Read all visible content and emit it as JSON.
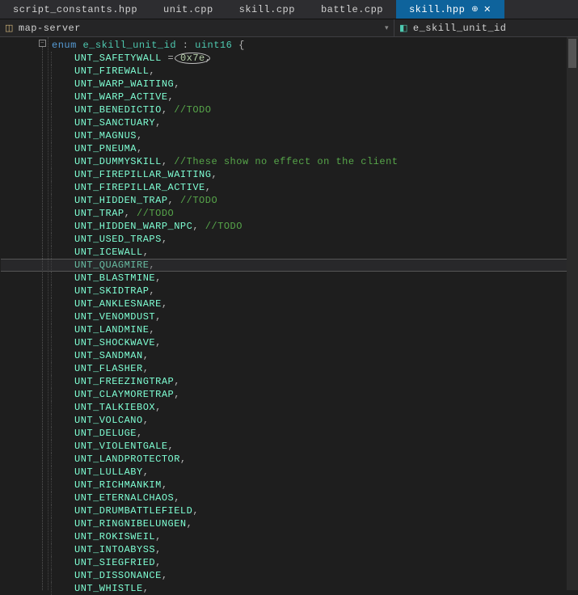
{
  "tabs": [
    {
      "label": "script_constants.hpp",
      "active": false
    },
    {
      "label": "unit.cpp",
      "active": false
    },
    {
      "label": "skill.cpp",
      "active": false
    },
    {
      "label": "battle.cpp",
      "active": false
    },
    {
      "label": "skill.hpp",
      "active": true
    }
  ],
  "subbar": {
    "left": "map-server",
    "right": "e_skill_unit_id"
  },
  "code": {
    "enum_kw": "enum",
    "enum_name": "e_skill_unit_id",
    "colon": ":",
    "base_type": "uint16",
    "brace": "{",
    "first_member": "UNT_SAFETYWALL",
    "eq": "=",
    "first_val": "0x7e",
    "comma": ",",
    "members": [
      {
        "name": "UNT_FIREWALL"
      },
      {
        "name": "UNT_WARP_WAITING"
      },
      {
        "name": "UNT_WARP_ACTIVE"
      },
      {
        "name": "UNT_BENEDICTIO",
        "comment": "//TODO"
      },
      {
        "name": "UNT_SANCTUARY"
      },
      {
        "name": "UNT_MAGNUS"
      },
      {
        "name": "UNT_PNEUMA"
      },
      {
        "name": "UNT_DUMMYSKILL",
        "comment": "//These show no effect on the client"
      },
      {
        "name": "UNT_FIREPILLAR_WAITING"
      },
      {
        "name": "UNT_FIREPILLAR_ACTIVE"
      },
      {
        "name": "UNT_HIDDEN_TRAP",
        "comment": "//TODO"
      },
      {
        "name": "UNT_TRAP",
        "comment": "//TODO"
      },
      {
        "name": "UNT_HIDDEN_WARP_NPC",
        "comment": "//TODO"
      },
      {
        "name": "UNT_USED_TRAPS"
      },
      {
        "name": "UNT_ICEWALL"
      },
      {
        "name": "UNT_QUAGMIRE",
        "highlight": true
      },
      {
        "name": "UNT_BLASTMINE"
      },
      {
        "name": "UNT_SKIDTRAP"
      },
      {
        "name": "UNT_ANKLESNARE"
      },
      {
        "name": "UNT_VENOMDUST"
      },
      {
        "name": "UNT_LANDMINE"
      },
      {
        "name": "UNT_SHOCKWAVE"
      },
      {
        "name": "UNT_SANDMAN"
      },
      {
        "name": "UNT_FLASHER"
      },
      {
        "name": "UNT_FREEZINGTRAP"
      },
      {
        "name": "UNT_CLAYMORETRAP"
      },
      {
        "name": "UNT_TALKIEBOX"
      },
      {
        "name": "UNT_VOLCANO"
      },
      {
        "name": "UNT_DELUGE"
      },
      {
        "name": "UNT_VIOLENTGALE"
      },
      {
        "name": "UNT_LANDPROTECTOR"
      },
      {
        "name": "UNT_LULLABY"
      },
      {
        "name": "UNT_RICHMANKIM"
      },
      {
        "name": "UNT_ETERNALCHAOS"
      },
      {
        "name": "UNT_DRUMBATTLEFIELD"
      },
      {
        "name": "UNT_RINGNIBELUNGEN"
      },
      {
        "name": "UNT_ROKISWEIL"
      },
      {
        "name": "UNT_INTOABYSS"
      },
      {
        "name": "UNT_SIEGFRIED"
      },
      {
        "name": "UNT_DISSONANCE"
      },
      {
        "name": "UNT_WHISTLE"
      }
    ]
  }
}
